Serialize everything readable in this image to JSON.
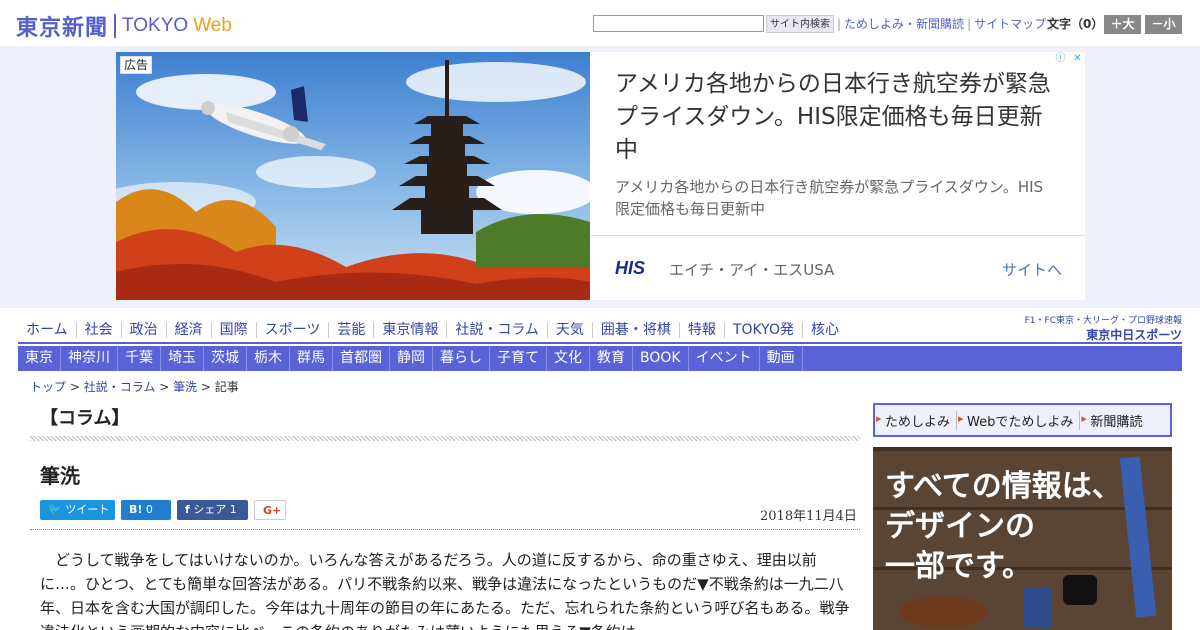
{
  "header": {
    "logo_jp": "東京新聞",
    "logo_en": "TOKYO",
    "logo_web": "Web",
    "search_placeholder": "",
    "search_button": "サイト内検索",
    "links": [
      "ためしよみ・新聞購読",
      "サイトマップ"
    ],
    "font_size_label": "文字（0）",
    "font_plus": "＋大",
    "font_minus": "－小"
  },
  "ad": {
    "label": "広告",
    "title": "アメリカ各地からの日本行き航空券が緊急プライスダウン。HIS限定価格も毎日更新中",
    "description": "アメリカ各地からの日本行き航空券が緊急プライスダウン。HIS限定価格も毎日更新中",
    "brand_logo": "HIS",
    "brand": "エイチ・アイ・エスUSA",
    "cta": "サイトへ"
  },
  "nav_main": [
    "ホーム",
    "社会",
    "政治",
    "経済",
    "国際",
    "スポーツ",
    "芸能",
    "東京情報",
    "社説・コラム",
    "天気",
    "囲碁・将棋",
    "特報",
    "TOKYO発",
    "核心"
  ],
  "chunichi": {
    "small": "F1・FC東京・大リーグ・プロ野球速報",
    "big": "東京中日スポーツ"
  },
  "nav_region": [
    "東京",
    "神奈川",
    "千葉",
    "埼玉",
    "茨城",
    "栃木",
    "群馬",
    "首都圏",
    "静岡",
    "暮らし",
    "子育て",
    "文化",
    "教育",
    "BOOK",
    "イベント",
    "動画"
  ],
  "breadcrumb": {
    "top": "トップ",
    "section": "社説・コラム",
    "sub": "筆洗",
    "current": "記事"
  },
  "article": {
    "section": "【コラム】",
    "title": "筆洗",
    "date": "2018年11月4日",
    "share": {
      "tweet": "ツイート",
      "hatena": "B!",
      "hatena_count": "0",
      "facebook": "シェア",
      "facebook_count": "1",
      "gplus": "G+"
    },
    "body": "どうして戦争をしてはいけないのか。いろんな答えがあるだろう。人の道に反するから、命の重さゆえ、理由以前に…。ひとつ、とても簡単な回答法がある。パリ不戦条約以来、戦争は違法になったというものだ▼不戦条約は一九二八年、日本を含む大国が調印した。今年は九十周年の節目の年にあたる。ただ、忘れられた条約という呼び名もある。戦争違法化という画期的な内容に比べ、この条約のありがたみは薄いようにも思える▼条約は"
  },
  "sidebar": {
    "links": [
      "ためしよみ",
      "Webでためしよみ",
      "新聞購読"
    ],
    "ad_lines": [
      "すべての情報は、",
      "デザインの",
      "一部です。"
    ]
  }
}
